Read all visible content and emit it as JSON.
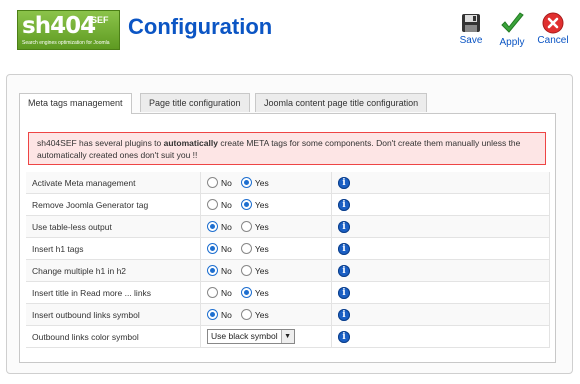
{
  "header": {
    "logo_main": "sh404",
    "logo_sup": "SEF",
    "logo_tagline": "Search engines optimization for Joomla",
    "title": "Configuration"
  },
  "toolbar": {
    "save_label": "Save",
    "apply_label": "Apply",
    "cancel_label": "Cancel"
  },
  "tabs": [
    {
      "label": "Meta tags management",
      "active": true
    },
    {
      "label": "Page title configuration",
      "active": false
    },
    {
      "label": "Joomla content page title configuration",
      "active": false
    }
  ],
  "notice": {
    "before": "sh404SEF has several plugins to ",
    "bold": "automatically",
    "after": " create META tags for some components. Don't create them manually unless the automatically created ones don't suit you !!"
  },
  "radio_labels": {
    "no": "No",
    "yes": "Yes"
  },
  "settings": [
    {
      "label": "Activate Meta management",
      "value": "Yes"
    },
    {
      "label": "Remove Joomla Generator tag",
      "value": "Yes"
    },
    {
      "label": "Use table-less output",
      "value": "No"
    },
    {
      "label": "Insert h1 tags",
      "value": "No"
    },
    {
      "label": "Change multiple h1 in h2",
      "value": "No"
    },
    {
      "label": "Insert title in Read more ... links",
      "value": "Yes"
    },
    {
      "label": "Insert outbound links symbol",
      "value": "No"
    },
    {
      "label": "Outbound links color symbol",
      "select": "Use black symbol"
    }
  ],
  "colors": {
    "title": "#0b55c4",
    "radio_selected": "#1e6fd0",
    "notice_border": "#ee4444"
  },
  "icons": {
    "save": "floppy-disk-icon",
    "apply": "checkmark-icon",
    "cancel": "cancel-icon",
    "info": "info-icon"
  }
}
